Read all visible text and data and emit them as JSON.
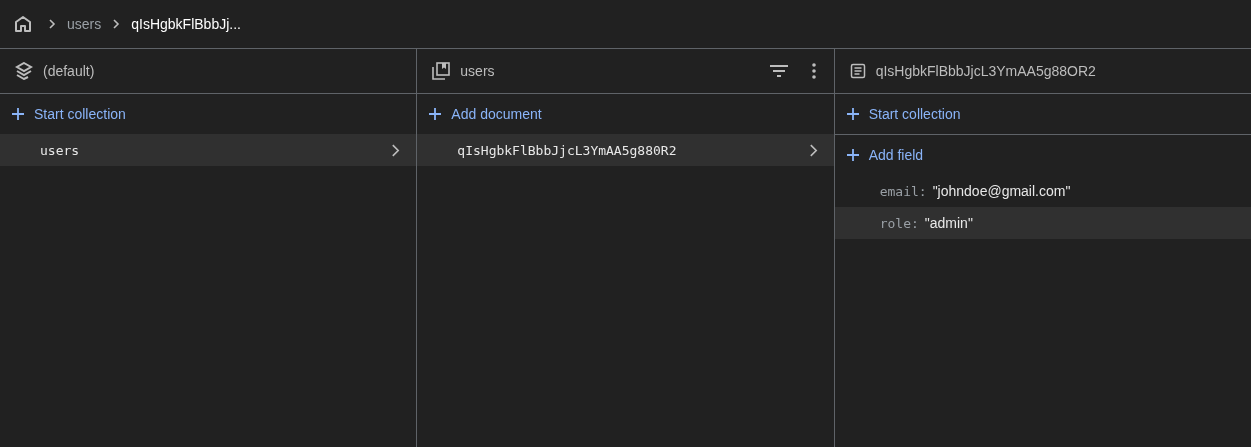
{
  "breadcrumb": [
    {
      "label": "users",
      "current": false
    },
    {
      "label": "qIsHgbkFlBbbJj...",
      "current": true
    }
  ],
  "panels": [
    {
      "kind": "database",
      "title": "(default)",
      "sections": [
        {
          "action": "Start collection",
          "items": [
            {
              "label": "users",
              "selected": true
            }
          ]
        }
      ]
    },
    {
      "kind": "collection",
      "title": "users",
      "sections": [
        {
          "action": "Add document",
          "items": [
            {
              "label": "qIsHgbkFlBbbJjcL3YmAA5g880R2",
              "selected": true
            }
          ]
        }
      ]
    },
    {
      "kind": "document",
      "title": "qIsHgbkFlBbbJjcL3YmAA5g88OR2",
      "sections": [
        {
          "action": "Start collection"
        },
        {
          "action": "Add field",
          "fields": [
            {
              "key": "email:",
              "value": "\"johndoe@gmail.com\"",
              "selected": false
            },
            {
              "key": "role:",
              "value": "\"admin\"",
              "selected": true
            }
          ]
        }
      ]
    }
  ]
}
